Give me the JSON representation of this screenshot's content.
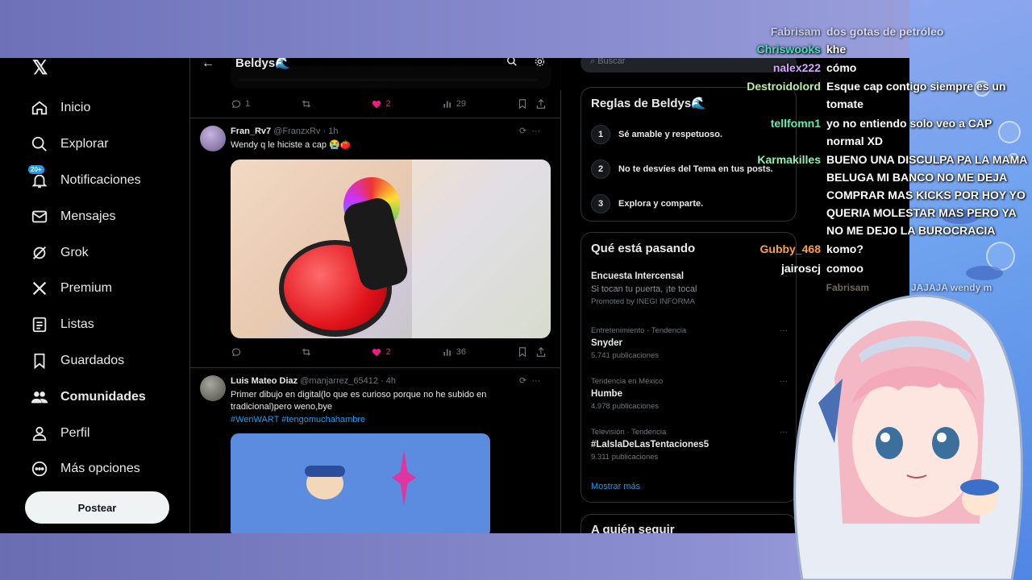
{
  "app": {
    "logo": "𝕏"
  },
  "sidebar": {
    "items": [
      {
        "label": "Inicio",
        "icon": "home-icon"
      },
      {
        "label": "Explorar",
        "icon": "search-icon"
      },
      {
        "label": "Notificaciones",
        "icon": "bell-icon",
        "badge": "20+"
      },
      {
        "label": "Mensajes",
        "icon": "mail-icon"
      },
      {
        "label": "Grok",
        "icon": "grok-icon"
      },
      {
        "label": "Premium",
        "icon": "x-icon"
      },
      {
        "label": "Listas",
        "icon": "list-icon"
      },
      {
        "label": "Guardados",
        "icon": "bookmark-icon"
      },
      {
        "label": "Comunidades",
        "icon": "people-icon"
      },
      {
        "label": "Perfil",
        "icon": "person-icon"
      },
      {
        "label": "Más opciones",
        "icon": "more-circle-icon"
      }
    ],
    "post_button": "Postear"
  },
  "main": {
    "title": "Beldys🌊",
    "prev_actions": {
      "replies": "1",
      "likes": "2",
      "views": "29"
    },
    "tweets": [
      {
        "name": "Fran_Rv7",
        "handle": "@FranzxRv",
        "time": "· 1h",
        "text": "Wendy q le hiciste a cap 😭🍅",
        "actions": {
          "replies": "",
          "likes": "2",
          "views": "36"
        }
      },
      {
        "name": "Luis Mateo Diaz",
        "handle": "@manjarrez_65412",
        "time": "· 4h",
        "text": "Primer dibujo en digital(lo que es curioso porque no he subido en tradicional)pero weno,bye",
        "hashtags": "#WenWART #tengomuchahambre"
      }
    ]
  },
  "right": {
    "search_placeholder": "Buscar",
    "rules": {
      "title": "Reglas de Beldys🌊",
      "items": [
        {
          "num": "1",
          "text": "Sé amable y respetuoso."
        },
        {
          "num": "2",
          "text": "No te desvíes del Tema en tus posts."
        },
        {
          "num": "3",
          "text": "Explora y comparte."
        }
      ]
    },
    "trends": {
      "title": "Qué está pasando",
      "items": [
        {
          "category": "",
          "name": "Encuesta Intercensal",
          "sub": "Si tocan tu puerta, ¡te tocal",
          "count": "Promoted by INEGI INFORMA"
        },
        {
          "category": "Entretenimiento · Tendencia",
          "name": "Snyder",
          "count": "5.741 publicaciones"
        },
        {
          "category": "Tendencia en México",
          "name": "Humbe",
          "count": "4.978 publicaciones"
        },
        {
          "category": "Televisión · Tendencia",
          "name": "#LaIslaDeLasTentaciones5",
          "count": "9.311 publicaciones"
        }
      ],
      "show_more": "Mostrar más"
    },
    "who_to_follow": "A quién seguir"
  },
  "chat": [
    {
      "user": "Fabrisam",
      "color": "#5fa0a0",
      "text": "dos gotas de petróleo"
    },
    {
      "user": "Chriswooks",
      "color": "#48e0c0",
      "text": "khe"
    },
    {
      "user": "nalex222",
      "color": "#d7a6ff",
      "text": "cómo"
    },
    {
      "user": "Destroidolord",
      "color": "#b8f0a0",
      "text": "Esque cap contigo siempre es un tomate"
    },
    {
      "user": "tellfomn1",
      "color": "#5cf0b0",
      "text": "yo no entiendo solo veo a CAP normal XD"
    },
    {
      "user": "Karmakilles",
      "color": "#8ff0b0",
      "text": "BUENO UNA DISCULPA PA LA MAMA BELUGA MI BANCO NO ME DEJA COMPRAR MAS KICKS POR HOY YO QUERIA MOLESTAR MAS PERO YA NO ME DEJO LA BUROCRACIA"
    },
    {
      "user": "Gubby_468",
      "color": "#ffa040",
      "text": "komo?"
    },
    {
      "user": "jairoscj",
      "color": "#ffffff",
      "text": "comoo"
    },
    {
      "user": "Fabrisam",
      "color": "#c8c0a0",
      "text": "JAJAJA wendy m"
    }
  ]
}
